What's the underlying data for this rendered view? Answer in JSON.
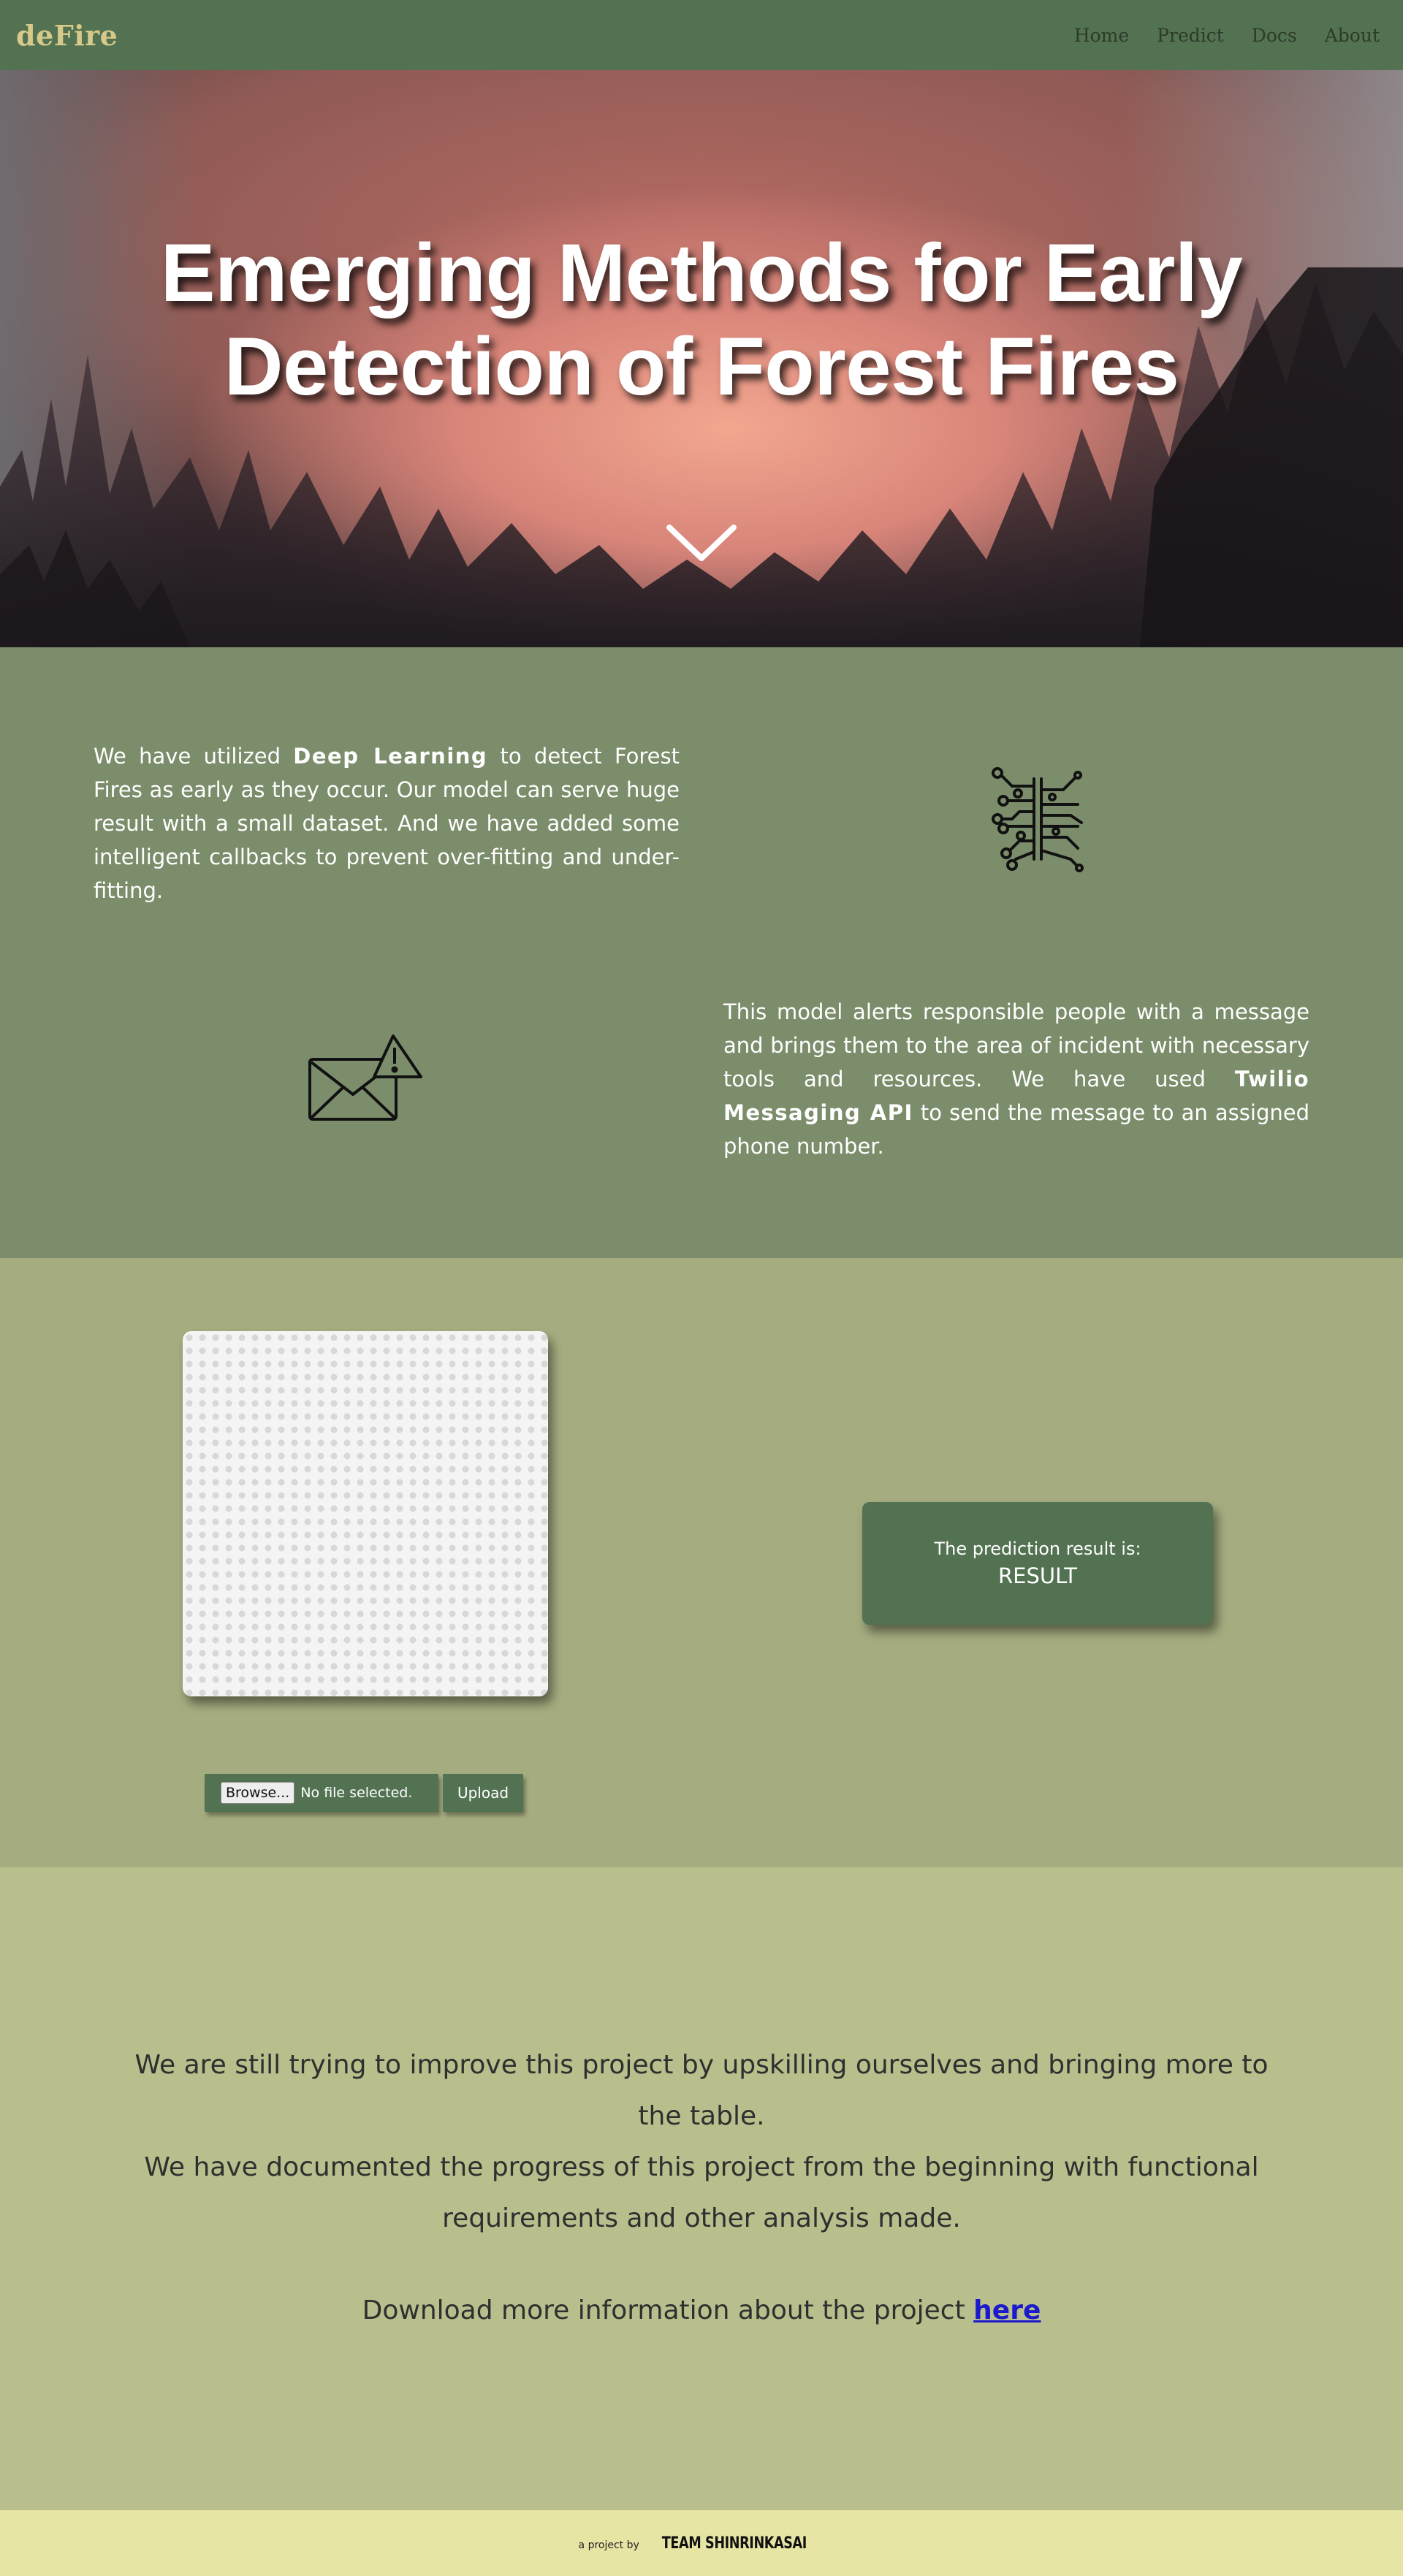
{
  "nav": {
    "brand": "deFire",
    "links": [
      "Home",
      "Predict",
      "Docs",
      "About"
    ]
  },
  "hero": {
    "title_line1": "Emerging Methods for Early",
    "title_line2": "Detection of Forest Fires",
    "scroll_icon": "chevron-down-icon"
  },
  "features": {
    "item1": {
      "pre": "We have utilized ",
      "bold": "Deep Learning",
      "post": " to detect Forest Fires as early as they occur. Our model can serve huge result with a small dataset. And we have added some intelligent callbacks to prevent over-fitting and under-fitting.",
      "icon": "circuit-chip-icon"
    },
    "item2": {
      "pre": "This model alerts responsible people with a message and brings them to the area of incident with necessary tools and resources. We have used ",
      "bold": "Twilio Messaging API",
      "post": " to send the message to an assigned phone number.",
      "icon": "mail-alert-icon"
    }
  },
  "predict": {
    "browse_label": "Browse...",
    "file_status": "No file selected.",
    "upload_label": "Upload",
    "result_label": "The prediction result is:",
    "result_value": "RESULT"
  },
  "info": {
    "line1": "We are still trying to improve this project by upskilling ourselves and bringing more to the table.",
    "line2": "We have documented the progress of this project from the beginning with functional requirements and other analysis made.",
    "download_text": "Download more information about the project ",
    "download_link": "here"
  },
  "footer": {
    "small": "a project by",
    "team": "TEAM SHINRINKASAI"
  },
  "colors": {
    "nav": "#527252",
    "brand": "#d6c98a",
    "features_bg": "#7b8d6a",
    "predict_bg": "#a5ad80",
    "info_bg": "#b8bf8c",
    "footer_bg": "#e6e5a4"
  }
}
